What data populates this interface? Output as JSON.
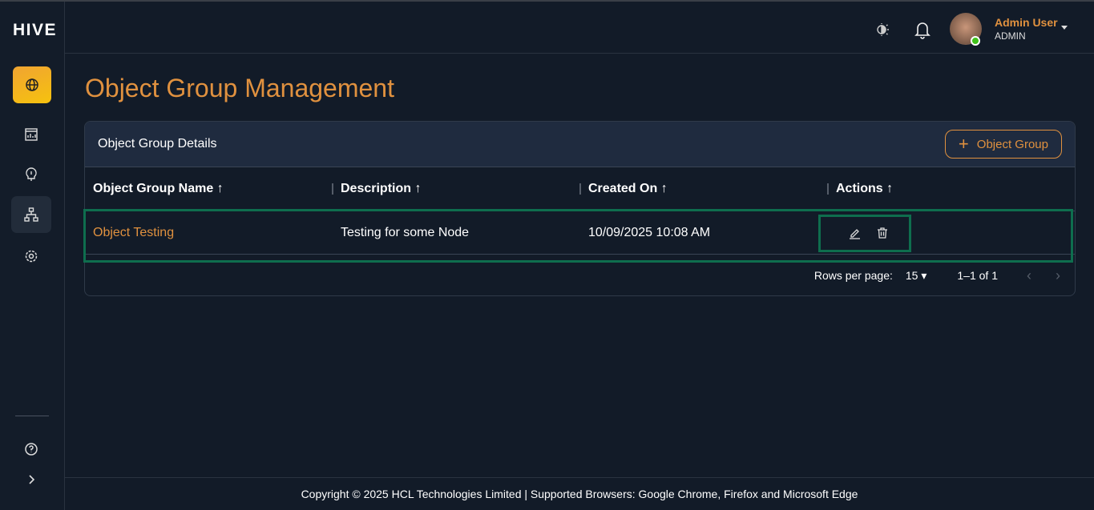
{
  "app": {
    "logo": "HIVE"
  },
  "user": {
    "name": "Admin User",
    "role": "ADMIN"
  },
  "page": {
    "title": "Object Group Management"
  },
  "card": {
    "title": "Object Group Details",
    "add_label": "Object Group"
  },
  "table": {
    "headers": [
      "Object Group Name",
      "Description",
      "Created On",
      "Actions"
    ],
    "rows": [
      {
        "name": "Object Testing",
        "description": "Testing for some Node",
        "created_on": "10/09/2025 10:08 AM"
      }
    ]
  },
  "pagination": {
    "rows_label": "Rows per page:",
    "rows_value": "15",
    "range": "1–1 of 1"
  },
  "footer": {
    "text": "Copyright © 2025 HCL Technologies Limited | Supported Browsers: Google Chrome, Firefox and Microsoft Edge"
  },
  "colors": {
    "accent": "#e0913f",
    "bg": "#121b28",
    "highlight": "#0e6e4e"
  }
}
